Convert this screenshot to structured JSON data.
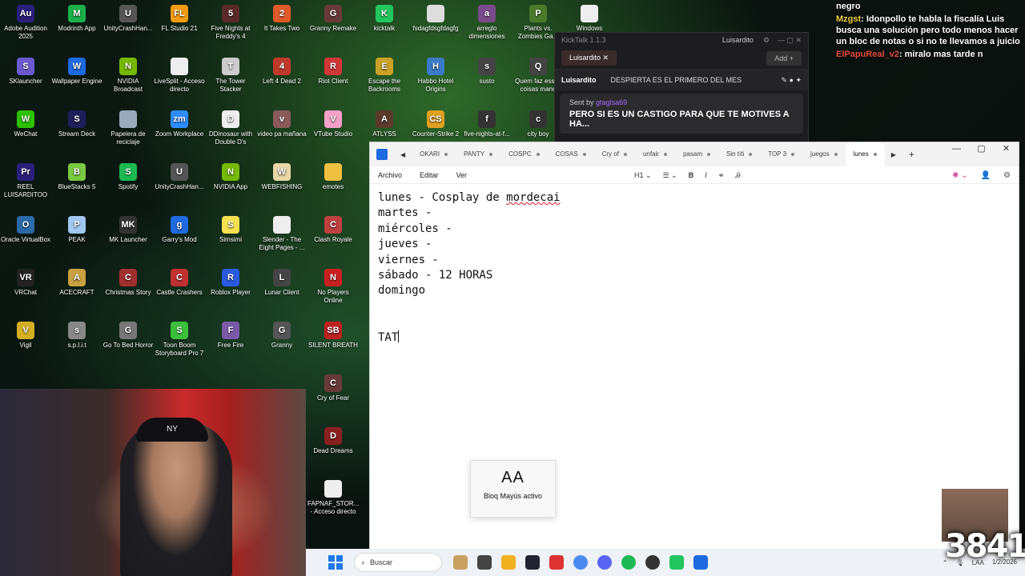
{
  "desktop": {
    "icons": [
      {
        "label": "Adobe Audition 2025",
        "glyph": "Au",
        "color": "#2a1f7a"
      },
      {
        "label": "Modrinth App",
        "glyph": "M",
        "color": "#1bb04a"
      },
      {
        "label": "UnityCrashHan...",
        "glyph": "U",
        "color": "#555555"
      },
      {
        "label": "FL Studio 21",
        "glyph": "FL",
        "color": "#f39c12"
      },
      {
        "label": "Five Nights at Freddy's 4",
        "glyph": "5",
        "color": "#5a2a2a"
      },
      {
        "label": "It Takes Two",
        "glyph": "2",
        "color": "#e05a2a"
      },
      {
        "label": "Granny Remake",
        "glyph": "G",
        "color": "#6a3a3a"
      },
      {
        "label": "kicktalk",
        "glyph": "K",
        "color": "#22c55e"
      },
      {
        "label": "fsdagfdsgfdagfg",
        "glyph": "",
        "color": "#dddddd"
      },
      {
        "label": "arreglo dimensiones",
        "glyph": "a",
        "color": "#7a4a8a"
      },
      {
        "label": "Plants vs. Zombies Ga...",
        "glyph": "P",
        "color": "#4a7a2a"
      },
      {
        "label": "Windows",
        "glyph": "",
        "color": "#eeeeee"
      },
      {
        "label": "SKlauncher",
        "glyph": "S",
        "color": "#6a5acd"
      },
      {
        "label": "Wallpaper Engine",
        "glyph": "W",
        "color": "#1e6ae0"
      },
      {
        "label": "NVIDIA Broadcast",
        "glyph": "N",
        "color": "#76b900"
      },
      {
        "label": "LiveSplit - Acceso directo",
        "glyph": "",
        "color": "#eeeeee"
      },
      {
        "label": "The Tower Stacker",
        "glyph": "T",
        "color": "#cccccc"
      },
      {
        "label": "Left 4 Dead 2",
        "glyph": "4",
        "color": "#c0392b"
      },
      {
        "label": "Riot Client",
        "glyph": "R",
        "color": "#d13639"
      },
      {
        "label": "Escape the Backrooms",
        "glyph": "E",
        "color": "#c9a227"
      },
      {
        "label": "Habbo Hotel Origins",
        "glyph": "H",
        "color": "#3a7ac8"
      },
      {
        "label": "susto",
        "glyph": "s",
        "color": "#444444"
      },
      {
        "label": "Quem faz essas coisas mano",
        "glyph": "Q",
        "color": "#444444"
      },
      {
        "label": "WeChat",
        "glyph": "W",
        "color": "#2dc100"
      },
      {
        "label": "Stream Deck",
        "glyph": "S",
        "color": "#1e1e5a"
      },
      {
        "label": "Papelera de reciclaje",
        "glyph": "",
        "color": "#9ab"
      },
      {
        "label": "Zoom Workplace",
        "glyph": "zm",
        "color": "#2d8cff"
      },
      {
        "label": "DDinosaur with Double D's",
        "glyph": "D",
        "color": "#eeeeee"
      },
      {
        "label": "video pa mañana",
        "glyph": "v",
        "color": "#8a5a5a"
      },
      {
        "label": "VTube Studio",
        "glyph": "V",
        "color": "#f5a0c8"
      },
      {
        "label": "ATLYSS",
        "glyph": "A",
        "color": "#5a3a2a"
      },
      {
        "label": "Counter-Strike 2",
        "glyph": "CS",
        "color": "#e0a020"
      },
      {
        "label": "five-nights-at-f...",
        "glyph": "f",
        "color": "#333333"
      },
      {
        "label": "city boy",
        "glyph": "c",
        "color": "#333333"
      },
      {
        "label": "REEL LUISARDITOO",
        "glyph": "Pr",
        "color": "#2a1f7a"
      },
      {
        "label": "BlueStacks 5",
        "glyph": "B",
        "color": "#7ac943"
      },
      {
        "label": "Spotify",
        "glyph": "S",
        "color": "#1db954"
      },
      {
        "label": "UnityCrashHan...",
        "glyph": "U",
        "color": "#555555"
      },
      {
        "label": "NVIDIA App",
        "glyph": "N",
        "color": "#76b900"
      },
      {
        "label": "WEBFISHING",
        "glyph": "W",
        "color": "#e8d8a8"
      },
      {
        "label": "emotes",
        "glyph": "",
        "color": "#f0c040"
      },
      {
        "label": "Oracle VirtualBox",
        "glyph": "O",
        "color": "#2a6aa8"
      },
      {
        "label": "PEAK",
        "glyph": "P",
        "color": "#a0c8f0"
      },
      {
        "label": "MK Launcher",
        "glyph": "MK",
        "color": "#333333"
      },
      {
        "label": "Garry's Mod",
        "glyph": "g",
        "color": "#1e6ae0"
      },
      {
        "label": "Simsimi",
        "glyph": "S",
        "color": "#f5e050"
      },
      {
        "label": "Slender - The Eight Pages - ...",
        "glyph": "",
        "color": "#eeeeee"
      },
      {
        "label": "Clash Royale",
        "glyph": "C",
        "color": "#c04040"
      },
      {
        "label": "VRChat",
        "glyph": "VR",
        "color": "#222222"
      },
      {
        "label": "ACECRAFT",
        "glyph": "A",
        "color": "#c8a040"
      },
      {
        "label": "Christmas Story",
        "glyph": "C",
        "color": "#a03030"
      },
      {
        "label": "Castle Crashers",
        "glyph": "C",
        "color": "#c03030"
      },
      {
        "label": "Roblox Player",
        "glyph": "R",
        "color": "#2a5ae0"
      },
      {
        "label": "Lunar Client",
        "glyph": "L",
        "color": "#444444"
      },
      {
        "label": "No Players Online",
        "glyph": "N",
        "color": "#c82020"
      },
      {
        "label": "Vigil",
        "glyph": "V",
        "color": "#d4b020"
      },
      {
        "label": "s.p.l.i.t",
        "glyph": "s",
        "color": "#888888"
      },
      {
        "label": "Go To Bed Horror",
        "glyph": "G",
        "color": "#777777"
      },
      {
        "label": "Toon Boom Storyboard Pro 7",
        "glyph": "S",
        "color": "#3ac03a"
      },
      {
        "label": "Free Fire",
        "glyph": "F",
        "color": "#7a5aa8"
      },
      {
        "label": "Granny",
        "glyph": "G",
        "color": "#555555"
      },
      {
        "label": "SILENT BREATH",
        "glyph": "SB",
        "color": "#c02020"
      },
      {
        "label": "Cry of Fear",
        "glyph": "C",
        "color": "#6a3a3a"
      },
      {
        "label": "Dead Dreams",
        "glyph": "D",
        "color": "#8a2020"
      },
      {
        "label": "FAPNAF_STOR... - Acceso directo",
        "glyph": "",
        "color": "#eeeeee"
      }
    ]
  },
  "chat_overlay": {
    "messages": [
      {
        "user": "",
        "text": "negro",
        "color": "#ffffff"
      },
      {
        "user": "Mzgst",
        "text": ": Idonpollo te habla la fiscalía Luis busca una solución pero todo menos hacer un bloc de notas o si no te llevamos a juicio",
        "color": "#f4d03f"
      },
      {
        "user": "ElPapuReal_v2",
        "text": ": miralo mas tarde n",
        "color": "#e74c3c"
      }
    ]
  },
  "kicktalk": {
    "title": "KickTalk 1.1.3",
    "user": "Luisardito",
    "tab": "Luisardito",
    "add_label": "Add +",
    "pinned_user": "Luisardito",
    "pinned_text": "DESPIERTA ES EL PRIMERO DEL MES",
    "sent_by": "Sent by",
    "sender": "gtaglsa69",
    "message": "PERO SI ES UN CASTIGO PARA QUE TE MOTIVES A HA..."
  },
  "notepad": {
    "tabs": [
      "OKARI",
      "PANTY",
      "COSPC",
      "COSAS",
      "Cry of",
      "unfair",
      "pasam",
      "Sin títi",
      "TOP 3",
      "juegos",
      "lunes"
    ],
    "active_tab_index": 10,
    "new_tab": "+",
    "menus": [
      "Archivo",
      "Editar",
      "Ver"
    ],
    "heading_select": "H1",
    "lines": [
      {
        "text": "lunes - Cosplay de ",
        "mis": "mordecai"
      },
      {
        "text": "martes -",
        "mis": ""
      },
      {
        "text": "miércoles -",
        "mis": ""
      },
      {
        "text": "jueves -",
        "mis": ""
      },
      {
        "text": "viernes -",
        "mis": ""
      },
      {
        "text": "sábado - 12 HORAS",
        "mis": ""
      },
      {
        "text": "domingo",
        "mis": ""
      },
      {
        "text": "",
        "mis": ""
      },
      {
        "text": "",
        "mis": ""
      },
      {
        "text": "TAT",
        "mis": ""
      }
    ]
  },
  "capslock": {
    "glyph": "AA",
    "text": "Bloq Mayús activo"
  },
  "webcam": {
    "cap_logo": "NY"
  },
  "taskbar": {
    "search_placeholder": "Buscar",
    "lang": "LAA",
    "date": "1/2/2026"
  },
  "viewer_count": "3841"
}
